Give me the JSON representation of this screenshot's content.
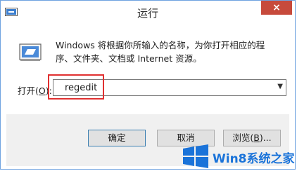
{
  "window": {
    "title": "运行",
    "close_label": "×",
    "title_icon": "run-window-icon"
  },
  "content": {
    "icon": "run-program-icon",
    "description": "Windows 将根据你所输入的名称，为你打开相应的程序、文件夹、文档或 Internet 资源。",
    "open_label_prefix": "打开(",
    "open_label_key": "O",
    "open_label_suffix": "):",
    "input_value": "regedit"
  },
  "buttons": {
    "ok": "确定",
    "cancel": "取消",
    "browse_prefix": "浏览(",
    "browse_key": "B",
    "browse_suffix": ")..."
  },
  "watermark": {
    "text": "Win8系统之家",
    "color": "#1a73d9"
  },
  "colors": {
    "highlight": "#e03030",
    "close_button": "#c74a3c"
  }
}
